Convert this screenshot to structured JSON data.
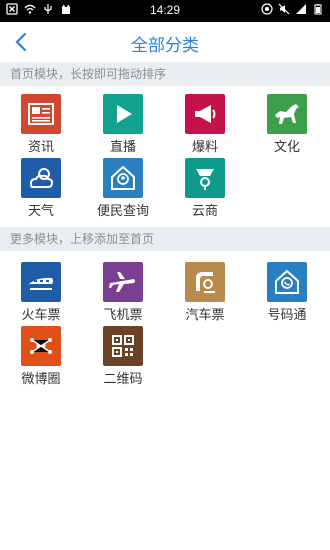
{
  "status_bar": {
    "time": "14:29"
  },
  "header": {
    "title": "全部分类"
  },
  "sections": [
    {
      "label": "首页模块，长按即可拖动排序",
      "items": [
        {
          "label": "资讯",
          "color": "#d2472e",
          "icon": "newspaper-icon"
        },
        {
          "label": "直播",
          "color": "#12a290",
          "icon": "play-icon"
        },
        {
          "label": "爆料",
          "color": "#c4134a",
          "icon": "megaphone-icon"
        },
        {
          "label": "文化",
          "color": "#3e9f4a",
          "icon": "horse-icon"
        },
        {
          "label": "天气",
          "color": "#1f5da8",
          "icon": "weather-icon"
        },
        {
          "label": "便民查询",
          "color": "#2a7fc0",
          "icon": "house-person-icon"
        },
        {
          "label": "云商",
          "color": "#0e9b8c",
          "icon": "cloud-shop-icon"
        }
      ]
    },
    {
      "label": "更多模块，上移添加至首页",
      "items": [
        {
          "label": "火车票",
          "color": "#1f5da8",
          "icon": "train-icon"
        },
        {
          "label": "飞机票",
          "color": "#7a3f90",
          "icon": "plane-icon"
        },
        {
          "label": "汽车票",
          "color": "#b88a4b",
          "icon": "bus-icon"
        },
        {
          "label": "号码通",
          "color": "#2a7fc0",
          "icon": "phonebook-icon"
        },
        {
          "label": "微博圈",
          "color": "#e04f18",
          "icon": "weibo-icon"
        },
        {
          "label": "二维码",
          "color": "#6b4226",
          "icon": "qrcode-icon"
        }
      ]
    }
  ]
}
